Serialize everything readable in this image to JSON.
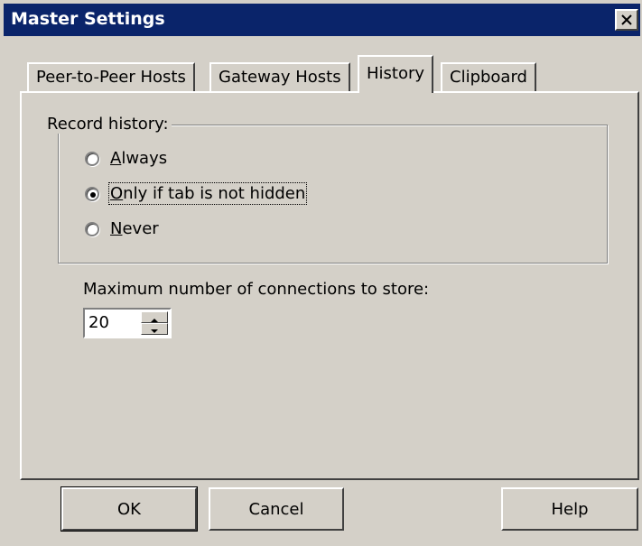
{
  "window": {
    "title": "Master Settings",
    "close_icon": "close-icon"
  },
  "tabs": [
    {
      "label": "Peer-to-Peer Hosts",
      "active": false
    },
    {
      "label": "Gateway Hosts",
      "active": false
    },
    {
      "label": "History",
      "active": true
    },
    {
      "label": "Clipboard",
      "active": false
    }
  ],
  "history": {
    "group_label": "Record history:",
    "options": [
      {
        "accel": "A",
        "rest": "lways",
        "checked": false
      },
      {
        "accel": "O",
        "rest": "nly if tab is not hidden",
        "checked": true
      },
      {
        "accel": "N",
        "rest": "ever",
        "checked": false
      }
    ],
    "max_connections_label": "Maximum number of connections to store:",
    "max_connections_value": "20"
  },
  "buttons": {
    "ok": "OK",
    "cancel": "Cancel",
    "help": "Help"
  },
  "colors": {
    "titlebar": "#0a246a",
    "face": "#d4d0c8"
  }
}
